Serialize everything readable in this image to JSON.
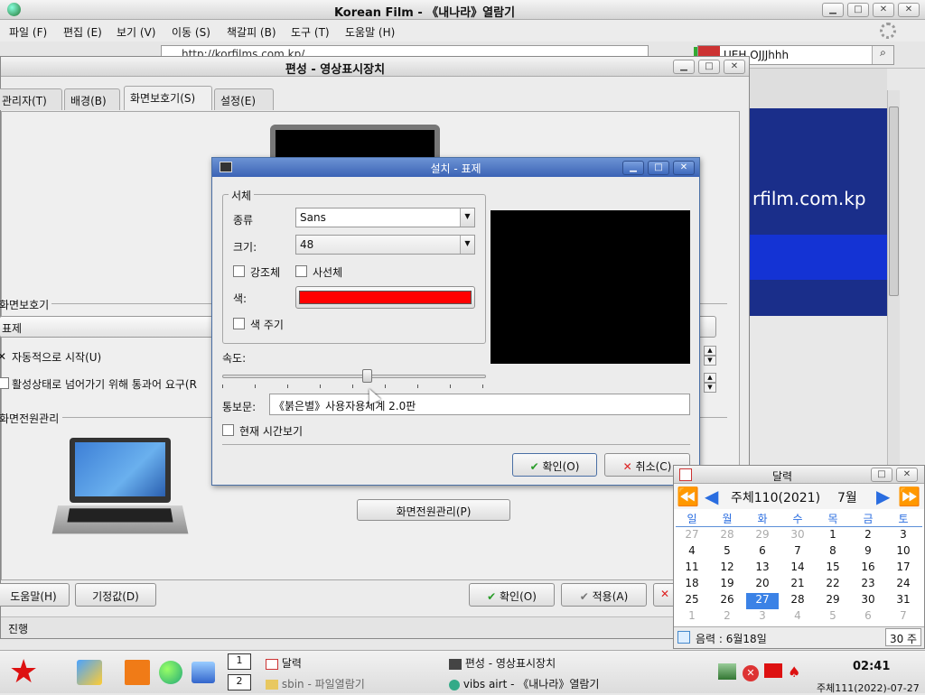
{
  "browser": {
    "title": "Korean Film - 《내나라》열람기",
    "menu": [
      "파일 (F)",
      "편집 (E)",
      "보기 (V)",
      "이동 (S)",
      "책갈피 (B)",
      "도구 (T)",
      "도움말 (H)"
    ],
    "url": "http://korfilms.com.kp/",
    "search_value": "UEH OJJJhhh",
    "site_text": "rfilm.com.kp"
  },
  "display_settings": {
    "title": "편성 - 영상표시장치",
    "tabs": [
      "관리자(T)",
      "배경(B)",
      "화면보호기(S)",
      "설정(E)"
    ],
    "screensaver_label": "화면보호기",
    "screensaver_value": "표제",
    "auto_start": "자동적으로 시작(U)",
    "require_password": "활성상태로 넘어가기 위해 통과어 요구(R",
    "power_section": "화면전원관리",
    "power_button": "화면전원관리(P)",
    "help_button": "도움말(H)",
    "default_button": "기정값(D)",
    "ok_button": "확인(O)",
    "apply_button": "적용(A)",
    "status": "진행"
  },
  "setup_dialog": {
    "title": "설치 - 표제",
    "font_group": "서체",
    "family_label": "종류",
    "family_value": "Sans",
    "size_label": "크기:",
    "size_value": "48",
    "bold_label": "강조체",
    "italic_label": "사선체",
    "color_label": "색:",
    "color_value": "#ff0000",
    "give_color_label": "색 주기",
    "speed_label": "속도:",
    "speed_value": 0.55,
    "text_label": "통보문:",
    "text_value": "《붉은별》사용자용체계 2.0판",
    "show_time_label": "현재 시간보기",
    "ok_button": "확인(O)",
    "cancel_button": "취소(C)"
  },
  "calendar": {
    "title": "달력",
    "year_label": "주체110(2021)",
    "month_label": "7월",
    "weekdays": [
      "일",
      "월",
      "화",
      "수",
      "목",
      "금",
      "토"
    ],
    "rows": [
      [
        "27",
        "28",
        "29",
        "30",
        "1",
        "2",
        "3"
      ],
      [
        "4",
        "5",
        "6",
        "7",
        "8",
        "9",
        "10"
      ],
      [
        "11",
        "12",
        "13",
        "14",
        "15",
        "16",
        "17"
      ],
      [
        "18",
        "19",
        "20",
        "21",
        "22",
        "23",
        "24"
      ],
      [
        "25",
        "26",
        "27",
        "28",
        "29",
        "30",
        "31"
      ],
      [
        "1",
        "2",
        "3",
        "4",
        "5",
        "6",
        "7"
      ]
    ],
    "selected_day": "27",
    "lunar": "음력 : 6월18일",
    "week": "30 주"
  },
  "taskbar": {
    "workspace_top": "1",
    "workspace_bottom": "2",
    "items": [
      "달력",
      "편성 - 영상표시장치",
      "sbin - 파일열람기",
      "vibs airt - 《내나라》열람기"
    ],
    "clock": "02:41",
    "date": "주체111(2022)-07-27"
  }
}
